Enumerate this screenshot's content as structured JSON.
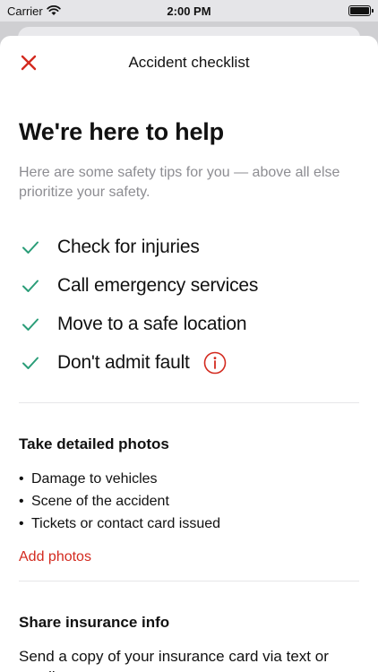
{
  "status_bar": {
    "carrier": "Carrier",
    "time": "2:00 PM",
    "wifi_icon": "wifi-icon",
    "battery_icon": "battery-icon",
    "battery_level": 1.0
  },
  "nav": {
    "title": "Accident checklist",
    "close_icon": "close-icon",
    "accent_color": "#d32a1f"
  },
  "hero": {
    "title": "We're here to help",
    "subtitle": "Here are some safety tips for you — above all else prioritize your safety."
  },
  "checklist": {
    "check_color": "#2a9d78",
    "items": [
      {
        "label": "Check for injuries"
      },
      {
        "label": "Call emergency services"
      },
      {
        "label": "Move to a safe location"
      },
      {
        "label": "Don't admit fault",
        "info_icon": "info-icon"
      }
    ]
  },
  "photos_section": {
    "title": "Take detailed photos",
    "bullets": [
      "Damage to vehicles",
      "Scene of the accident",
      "Tickets or contact card issued"
    ],
    "link_label": "Add photos"
  },
  "insurance_section": {
    "title": "Share insurance info",
    "body": "Send a copy of your insurance card via text or email."
  }
}
